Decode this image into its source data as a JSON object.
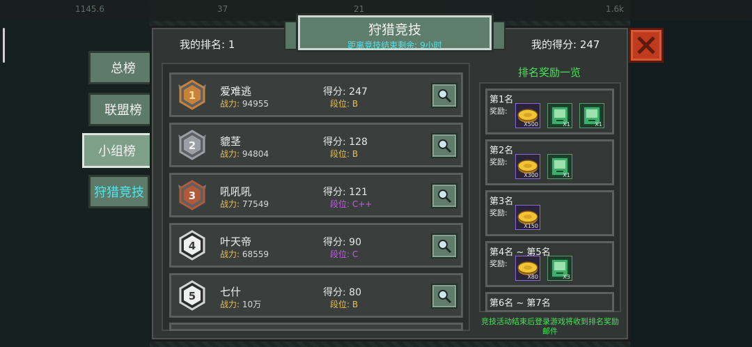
{
  "topbar": {
    "stat1": "1145.6",
    "stat2": "37",
    "stat3": "21",
    "stat4": "1.6k"
  },
  "side_tabs": [
    {
      "label": "总榜",
      "active": false
    },
    {
      "label": "联盟榜",
      "active": false
    },
    {
      "label": "小组榜",
      "active": true
    },
    {
      "label": "狩猎竞技",
      "active": false
    }
  ],
  "header": {
    "my_rank": "我的排名: 1",
    "my_score": "我的得分: 247",
    "title": "狩猎竞技",
    "subtitle": "距离竞技结束剩余: 9小时"
  },
  "ranking": [
    {
      "rank": "1",
      "name": "爱难逃",
      "power_label": "战力:",
      "power": "94955",
      "score": "得分: 247",
      "tier": "段位: B",
      "tier_color": "gold"
    },
    {
      "rank": "2",
      "name": "貔茎",
      "power_label": "战力:",
      "power": "94804",
      "score": "得分: 128",
      "tier": "段位: B",
      "tier_color": "gold"
    },
    {
      "rank": "3",
      "name": "吼吼吼",
      "power_label": "战力:",
      "power": "77549",
      "score": "得分: 121",
      "tier": "段位: C++",
      "tier_color": "purple"
    },
    {
      "rank": "4",
      "name": "叶天帝",
      "power_label": "战力:",
      "power": "68559",
      "score": "得分: 90",
      "tier": "段位: C",
      "tier_color": "purple"
    },
    {
      "rank": "5",
      "name": "七什",
      "power_label": "战力:",
      "power": "10万",
      "score": "得分: 80",
      "tier": "段位: B",
      "tier_color": "gold"
    }
  ],
  "rewards": {
    "title": "排名奖励一览",
    "reward_label": "奖励:",
    "tiers": [
      {
        "rank": "第1名",
        "items": [
          {
            "icon": "gold-coin-icon",
            "qty": "X500"
          },
          {
            "icon": "green-card-icon",
            "qty": "X1"
          },
          {
            "icon": "green-card-icon",
            "qty": "X1"
          }
        ]
      },
      {
        "rank": "第2名",
        "items": [
          {
            "icon": "gold-coin-icon",
            "qty": "X300"
          },
          {
            "icon": "green-card-icon",
            "qty": "X1"
          }
        ]
      },
      {
        "rank": "第3名",
        "items": [
          {
            "icon": "gold-coin-icon",
            "qty": "X150"
          }
        ]
      },
      {
        "rank": "第4名 ~ 第5名",
        "items": [
          {
            "icon": "gold-coin-icon",
            "qty": "X80"
          },
          {
            "icon": "green-card-icon",
            "qty": "X3"
          }
        ]
      },
      {
        "rank": "第6名 ~ 第7名",
        "items": []
      }
    ],
    "footer": "竞技活动结束后登录游戏将收到排名奖励邮件"
  },
  "colors": {
    "accent_green": "#46e35a",
    "accent_cyan": "#4de7f0",
    "gold": "#e8c04a",
    "purple": "#c45ae8",
    "close_red": "#bf3a1e"
  }
}
